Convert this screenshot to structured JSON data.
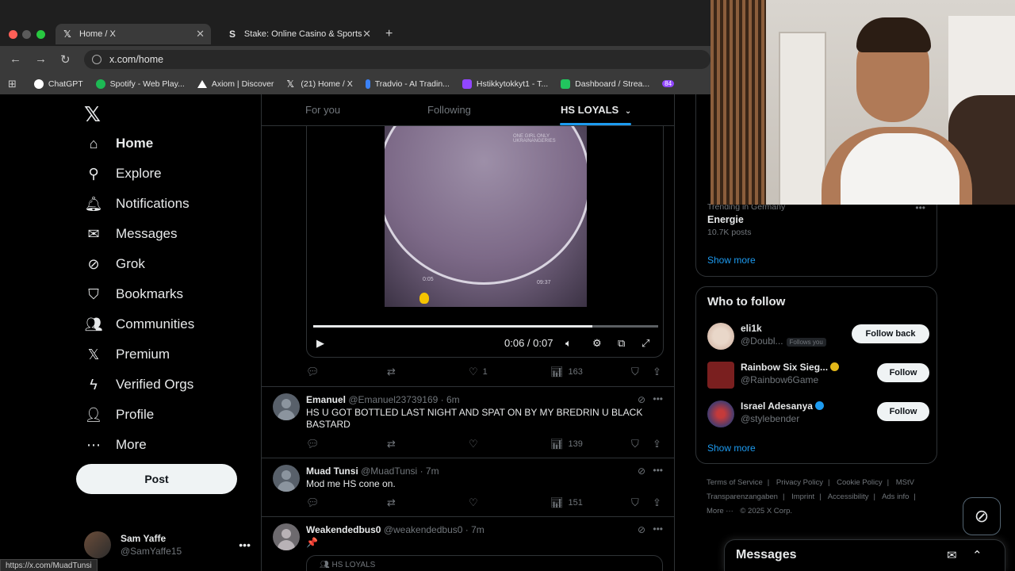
{
  "browser": {
    "tabs": [
      {
        "label": "Home / X",
        "icon": "x-logo-icon",
        "active": true
      },
      {
        "label": "Stake: Online Casino & Sports",
        "icon": "stake-icon",
        "active": false
      }
    ],
    "url": "x.com/home",
    "bookmarks": [
      {
        "label": "ChatGPT",
        "color": "#ffffff"
      },
      {
        "label": "Spotify - Web Play...",
        "color": "#1db954"
      },
      {
        "label": "Axiom | Discover",
        "color": "#ffffff"
      },
      {
        "label": "(21) Home / X",
        "color": "#ffffff"
      },
      {
        "label": "Tradvio - AI Tradin...",
        "color": "#3b82f6"
      },
      {
        "label": "Hstikkytokkyt1 - T...",
        "color": "#9146ff"
      },
      {
        "label": "Dashboard / Strea...",
        "color": "#22c55e"
      },
      {
        "label": "84",
        "color": "#9146ff"
      }
    ],
    "status_url": "https://x.com/MuadTunsi"
  },
  "nav": {
    "items": [
      {
        "label": "Home",
        "icon": "home-icon"
      },
      {
        "label": "Explore",
        "icon": "search-icon"
      },
      {
        "label": "Notifications",
        "icon": "bell-icon"
      },
      {
        "label": "Messages",
        "icon": "envelope-icon"
      },
      {
        "label": "Grok",
        "icon": "grok-icon"
      },
      {
        "label": "Bookmarks",
        "icon": "bookmark-icon"
      },
      {
        "label": "Communities",
        "icon": "communities-icon"
      },
      {
        "label": "Premium",
        "icon": "x-logo-icon"
      },
      {
        "label": "Verified Orgs",
        "icon": "lightning-icon"
      },
      {
        "label": "Profile",
        "icon": "person-icon"
      },
      {
        "label": "More",
        "icon": "more-circle-icon"
      }
    ],
    "post_label": "Post",
    "account": {
      "name": "Sam Yaffe",
      "handle": "@SamYaffe15"
    }
  },
  "timeline": {
    "tabs": [
      "For you",
      "Following",
      "HS LOYALS"
    ],
    "video": {
      "time": "0:06 / 0:07",
      "progress": 0.81,
      "watermark": "ONE GIRL ONLY UKRAINANGERIES",
      "overlay_ts1": "0:05",
      "overlay_ts2": "09:37"
    },
    "video_tweet_actions": {
      "likes": "1",
      "views": "163"
    },
    "tweets": [
      {
        "name": "Emanuel",
        "handle": "@Emanuel23739169",
        "time": "· 6m",
        "text": "HS U GOT BOTTLED LAST NIGHT AND SPAT ON BY MY BREDRIN U BLACK BASTARD",
        "views": "139"
      },
      {
        "name": "Muad Tunsi",
        "handle": "@MuadTunsi",
        "time": "· 7m",
        "text": "Mod me HS cone on.",
        "views": "151"
      },
      {
        "name": "Weakendedbus0",
        "handle": "@weakendedbus0",
        "time": "· 7m",
        "text": "📌",
        "community": "HS LOYALS"
      }
    ]
  },
  "sidebar": {
    "trend": {
      "meta": "Trending in Germany",
      "name": "Energie",
      "posts": "10.7K posts"
    },
    "show_more": "Show more",
    "who_to_follow": {
      "title": "Who to follow",
      "items": [
        {
          "name": "eli1k",
          "handle": "@Doubl...",
          "badge": "Follows you",
          "button": "Follow back"
        },
        {
          "name": "Rainbow Six Sieg...",
          "handle": "@Rainbow6Game",
          "button": "Follow"
        },
        {
          "name": "Israel Adesanya",
          "handle": "@stylebender",
          "button": "Follow"
        }
      ],
      "show_more": "Show more"
    },
    "footer": [
      "Terms of Service",
      "|",
      "Privacy Policy",
      "|",
      "Cookie Policy",
      "|",
      "MStV Transparenzangaben",
      "|",
      "Imprint",
      "|",
      "Accessibility",
      "|",
      "Ads info",
      "|",
      "More ···",
      "© 2025 X Corp."
    ]
  },
  "messages_drawer": {
    "title": "Messages"
  }
}
